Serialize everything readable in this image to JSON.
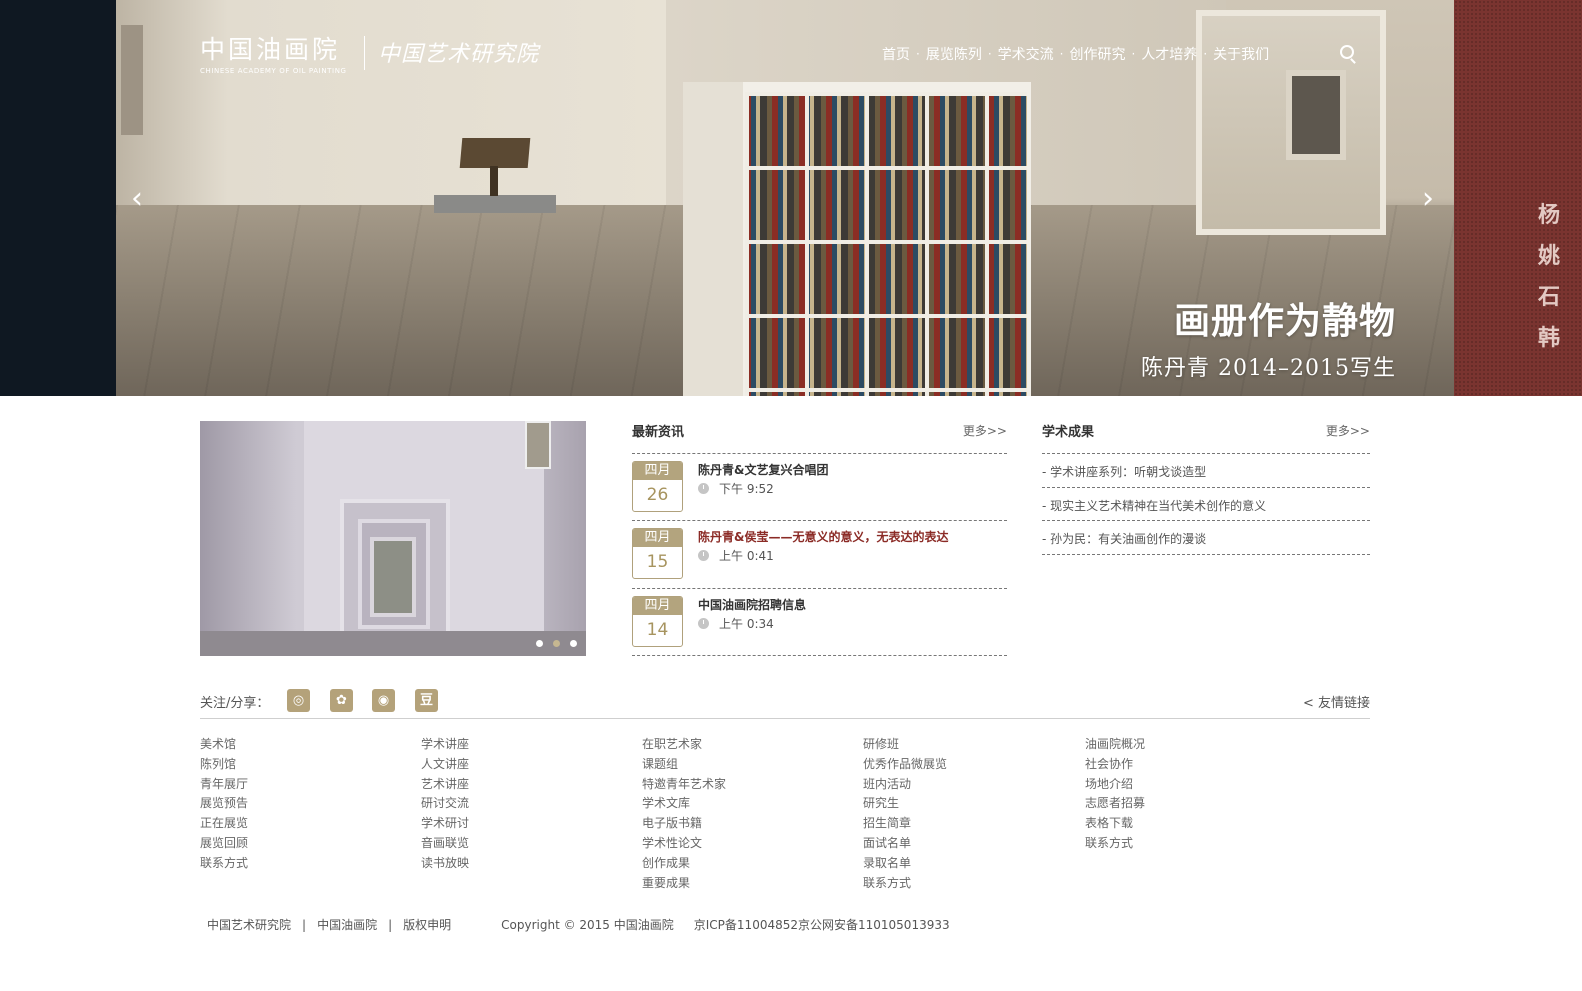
{
  "header": {
    "logo_cn": "中国油画院",
    "logo_en": "CHINESE ACADEMY OF OIL PAINTING",
    "logo_calligraphy": "中国艺术研究院",
    "nav": [
      "首页",
      "展览陈列",
      "学术交流",
      "创作研究",
      "人才培养",
      "关于我们"
    ],
    "search_icon": "search-icon"
  },
  "hero": {
    "title": "画册作为静物",
    "subtitle": "陈丹青 2014–2015写生",
    "prev_arrow": "‹",
    "next_arrow": "›",
    "side_names": [
      "杨",
      "姚",
      "石",
      "韩"
    ]
  },
  "feature": {
    "slide_count": 3,
    "active_slide": 2
  },
  "news": {
    "title": "最新资讯",
    "more": "更多>>",
    "items": [
      {
        "month": "四月",
        "day": "26",
        "headline": "陈丹青&文艺复兴合唱团",
        "time": "下午 9:52"
      },
      {
        "month": "四月",
        "day": "15",
        "headline": "陈丹青&侯莹——无意义的意义，无表达的表达",
        "time": "上午 0:41",
        "highlight": true
      },
      {
        "month": "四月",
        "day": "14",
        "headline": "中国油画院招聘信息",
        "time": "上午 0:34"
      }
    ]
  },
  "academic": {
    "title": "学术成果",
    "more": "更多>>",
    "items": [
      "- 学术讲座系列：听朝戈谈造型",
      "- 现实主义艺术精神在当代美术创作的意义",
      "- 孙为民：有关油画创作的漫谈"
    ]
  },
  "social": {
    "label": "关注/分享：",
    "icons": [
      {
        "name": "wechat-icon",
        "glyph": "◎"
      },
      {
        "name": "camera-icon",
        "glyph": "✿"
      },
      {
        "name": "weibo-icon",
        "glyph": "◉"
      },
      {
        "name": "douban-icon",
        "glyph": "豆"
      }
    ],
    "friend_links": "< 友情链接"
  },
  "footer_columns": [
    [
      "美术馆",
      "陈列馆",
      "青年展厅",
      "展览预告",
      "正在展览",
      "展览回顾",
      "联系方式"
    ],
    [
      "学术讲座",
      "人文讲座",
      "艺术讲座",
      "研讨交流",
      "学术研讨",
      "音画联览",
      "读书放映"
    ],
    [
      "在职艺术家",
      "课题组",
      "特邀青年艺术家",
      "学术文库",
      "电子版书籍",
      "学术性论文",
      "创作成果",
      "重要成果"
    ],
    [
      "研修班",
      "优秀作品微展览",
      "班内活动",
      "研究生",
      "招生简章",
      "面试名单",
      "录取名单",
      "联系方式"
    ],
    [
      "油画院概况",
      "社会协作",
      "场地介绍",
      "志愿者招募",
      "表格下载",
      "联系方式"
    ]
  ],
  "bottom": {
    "links": [
      "中国艺术研究院",
      "中国油画院",
      "版权申明"
    ],
    "separator": "|",
    "copyright": "Copyright © 2015 中国油画院",
    "icp": "京ICP备11004852京公网安备110105013933"
  },
  "colors": {
    "accent_gold": "#b3a47e",
    "highlight_red": "#8b2b26",
    "hero_left_panel": "#0f1822",
    "hero_right_panel": "#7a3430"
  }
}
